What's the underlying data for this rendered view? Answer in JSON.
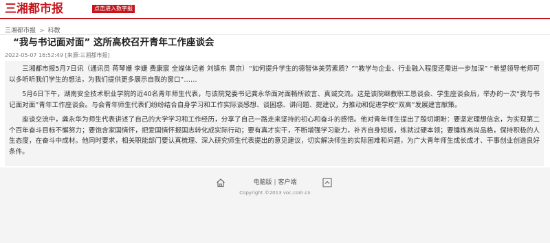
{
  "header": {
    "logo_text": "三湘都市报",
    "logo_tag": "点击进入数字报"
  },
  "breadcrumb": {
    "home": "三湘都市报",
    "separator": ">",
    "section": "科教"
  },
  "article": {
    "title": "“我与书记面对面” 这所高校召开青年工作座谈会",
    "meta": "2022-05-07 16:52:49 [来源:三湘都市报]",
    "paragraphs": [
      "三湘都市报5月7日讯（通讯员 蒋琴姗 李婕 费康宸 全媒体记者 刘镇东 黄京）“如何提升学生的德智体美劳素质？”“教学与企业、行业融入程度还需进一步加深” “希望领导老师可以多听听我们学生的想法，为我们提供更多展示自我的窗口”……",
      "5月6日下午，湖南安全技术职业学院的近40名青年师生代表，与该院党委书记龚永华面对面畅所欲言、真诚交流。这是该院继教职工恳谈会、学生座谈会后，举办的一次“我与书记面对面”青年工作座谈会。与会青年师生代表们纷纷结合自身学习和工作实际谈感想、谈困惑、讲问题、提建议，为推动和促进学校“双高”发展建言献策。",
      "座谈交流中，龚永华为师生代表讲述了自己的大学学习和工作经历，分享了自己一路走来坚持的初心和奋斗的感悟。他对青年师生提出了殷切期盼：要坚定理想信念，为实现第二个百年奋斗目标不懈努力；要饱含家国情怀，把爱国情怀报国志转化成实际行动；要有真才实干，不断增强学习能力，补齐自身短板，练就过硬本领；要锤炼高尚品格，保持积极的人生态度，在奋斗中成材。他同时要求，相关职能部门要认真梳理、深入研究师生代表提出的意见建议，切实解决师生的实际困难和问题，为广大青年师生成长成才、干事创业创造良好条件。"
    ]
  },
  "footer": {
    "home_icon": "home-icon",
    "top_icon": "back-to-top-icon",
    "pc_link": "电脑版",
    "separator": "|",
    "client_link": "客户端",
    "copyright": "Copyright ©2013 voc.com.cn"
  },
  "colors": {
    "brand": "#c4161c",
    "background": "#f4f4f4"
  }
}
